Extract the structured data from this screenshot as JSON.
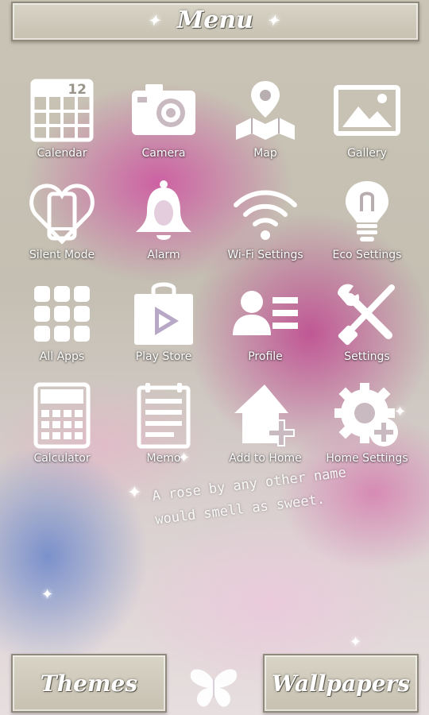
{
  "header": {
    "title": "Menu"
  },
  "apps": [
    {
      "label": "Calendar",
      "icon": "calendar-icon",
      "badge": "12"
    },
    {
      "label": "Camera",
      "icon": "camera-icon"
    },
    {
      "label": "Map",
      "icon": "map-icon"
    },
    {
      "label": "Gallery",
      "icon": "gallery-icon"
    },
    {
      "label": "Silent Mode",
      "icon": "silent-mode-icon"
    },
    {
      "label": "Alarm",
      "icon": "alarm-bell-icon"
    },
    {
      "label": "Wi-Fi Settings",
      "icon": "wifi-icon"
    },
    {
      "label": "Eco Settings",
      "icon": "lightbulb-icon"
    },
    {
      "label": "All Apps",
      "icon": "all-apps-grid-icon"
    },
    {
      "label": "Play Store",
      "icon": "play-store-bag-icon"
    },
    {
      "label": "Profile",
      "icon": "profile-card-icon"
    },
    {
      "label": "Settings",
      "icon": "wrench-screwdriver-icon"
    },
    {
      "label": "Calculator",
      "icon": "calculator-icon"
    },
    {
      "label": "Memo",
      "icon": "memo-notepad-icon"
    },
    {
      "label": "Add to Home",
      "icon": "add-to-home-icon"
    },
    {
      "label": "Home Settings",
      "icon": "home-settings-gear-icon"
    }
  ],
  "quote": {
    "line1": "A rose by any other name",
    "line2": "would smell as sweet."
  },
  "footer": {
    "themes_label": "Themes",
    "wallpapers_label": "Wallpapers",
    "center_icon": "butterfly-icon"
  },
  "colors": {
    "icon": "#ffffff",
    "frame": "#c9c4b5",
    "accent_pink": "#c6509e"
  }
}
